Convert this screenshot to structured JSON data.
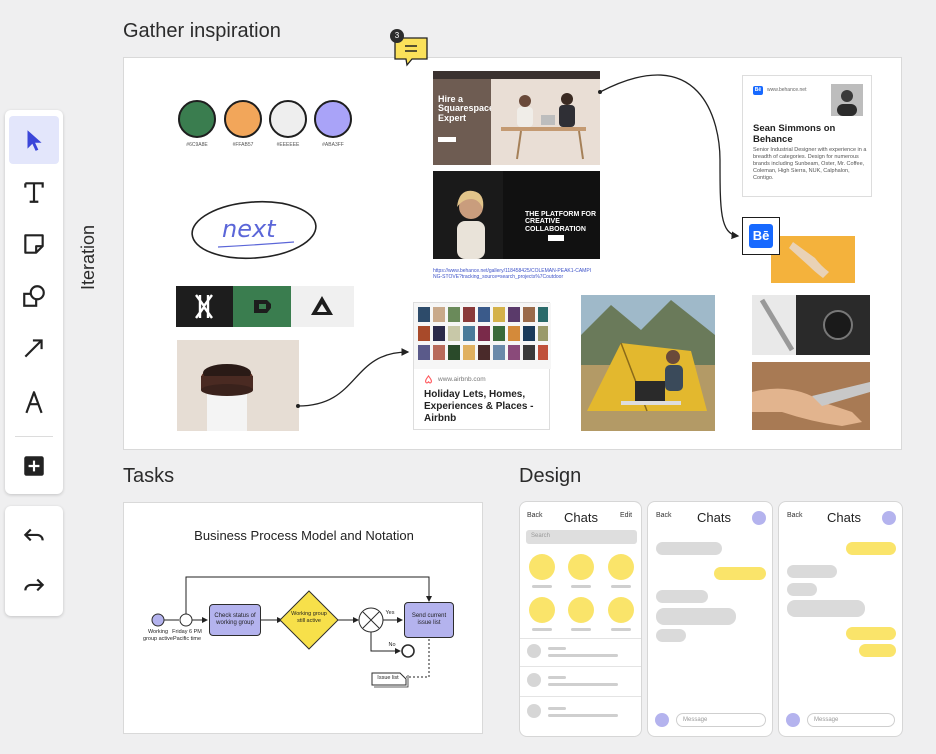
{
  "sections": {
    "gather": "Gather inspiration",
    "tasks": "Tasks",
    "design": "Design",
    "iteration": "Iteration"
  },
  "comment_badge": {
    "count": "3"
  },
  "swatches": [
    {
      "hex": "#6C9A8E",
      "label": "#6C9A8E"
    },
    {
      "hex": "#FFAB57",
      "label": "#FFAB57"
    },
    {
      "hex": "#EEEEEE",
      "label": "#EEEEEE"
    },
    {
      "hex": "#ABA3FF",
      "label": "#ABA3FF"
    }
  ],
  "colors": {
    "green": "#3a7d4f",
    "orange": "#f2a65a",
    "light": "#eeeeee",
    "lavender": "#a9a3f8",
    "dark": "#1d1d1d",
    "yellow": "#fae46a"
  },
  "handwriting": "next",
  "squarespace": {
    "headline": "Hire a Squarespace Expert"
  },
  "behance_banner": {
    "headline": "THE PLATFORM FOR CREATIVE COLLABORATION",
    "url": "https://www.behance.net/gallery/118458425/COLEMAN-PEAK1-CAMPING-STOVE?tracking_source=search_projects%7Coutdoor"
  },
  "behance_card": {
    "domain": "www.behance.net",
    "name": "Sean Simmons on Behance",
    "bio": "Senior Industrial Designer with experience in a breadth of categories. Design for numerous brands including Sunbeam, Oster, Mr. Coffee, Coleman, High Sierra, NUK, Calphalon, Contigo."
  },
  "behance_logo": "Bē",
  "airbnb_card": {
    "domain": "www.airbnb.com",
    "title": "Holiday Lets, Homes, Experiences & Places - Airbnb"
  },
  "bpmn": {
    "title": "Business Process Model and Notation",
    "start_label": "Working group active",
    "timer_label": "Friday 6 PM Pacific time",
    "task1": "Check status of working group",
    "gateway": "Working group still active",
    "yes": "Yes",
    "no": "No",
    "task2": "Send current issue list",
    "doc": "Issue list"
  },
  "phones": [
    {
      "back": "Back",
      "title": "Chats",
      "edit": "Edit",
      "search": "Search",
      "message": ""
    },
    {
      "back": "Back",
      "title": "Chats",
      "message": "Message"
    },
    {
      "back": "Back",
      "title": "Chats",
      "message": "Message"
    }
  ]
}
